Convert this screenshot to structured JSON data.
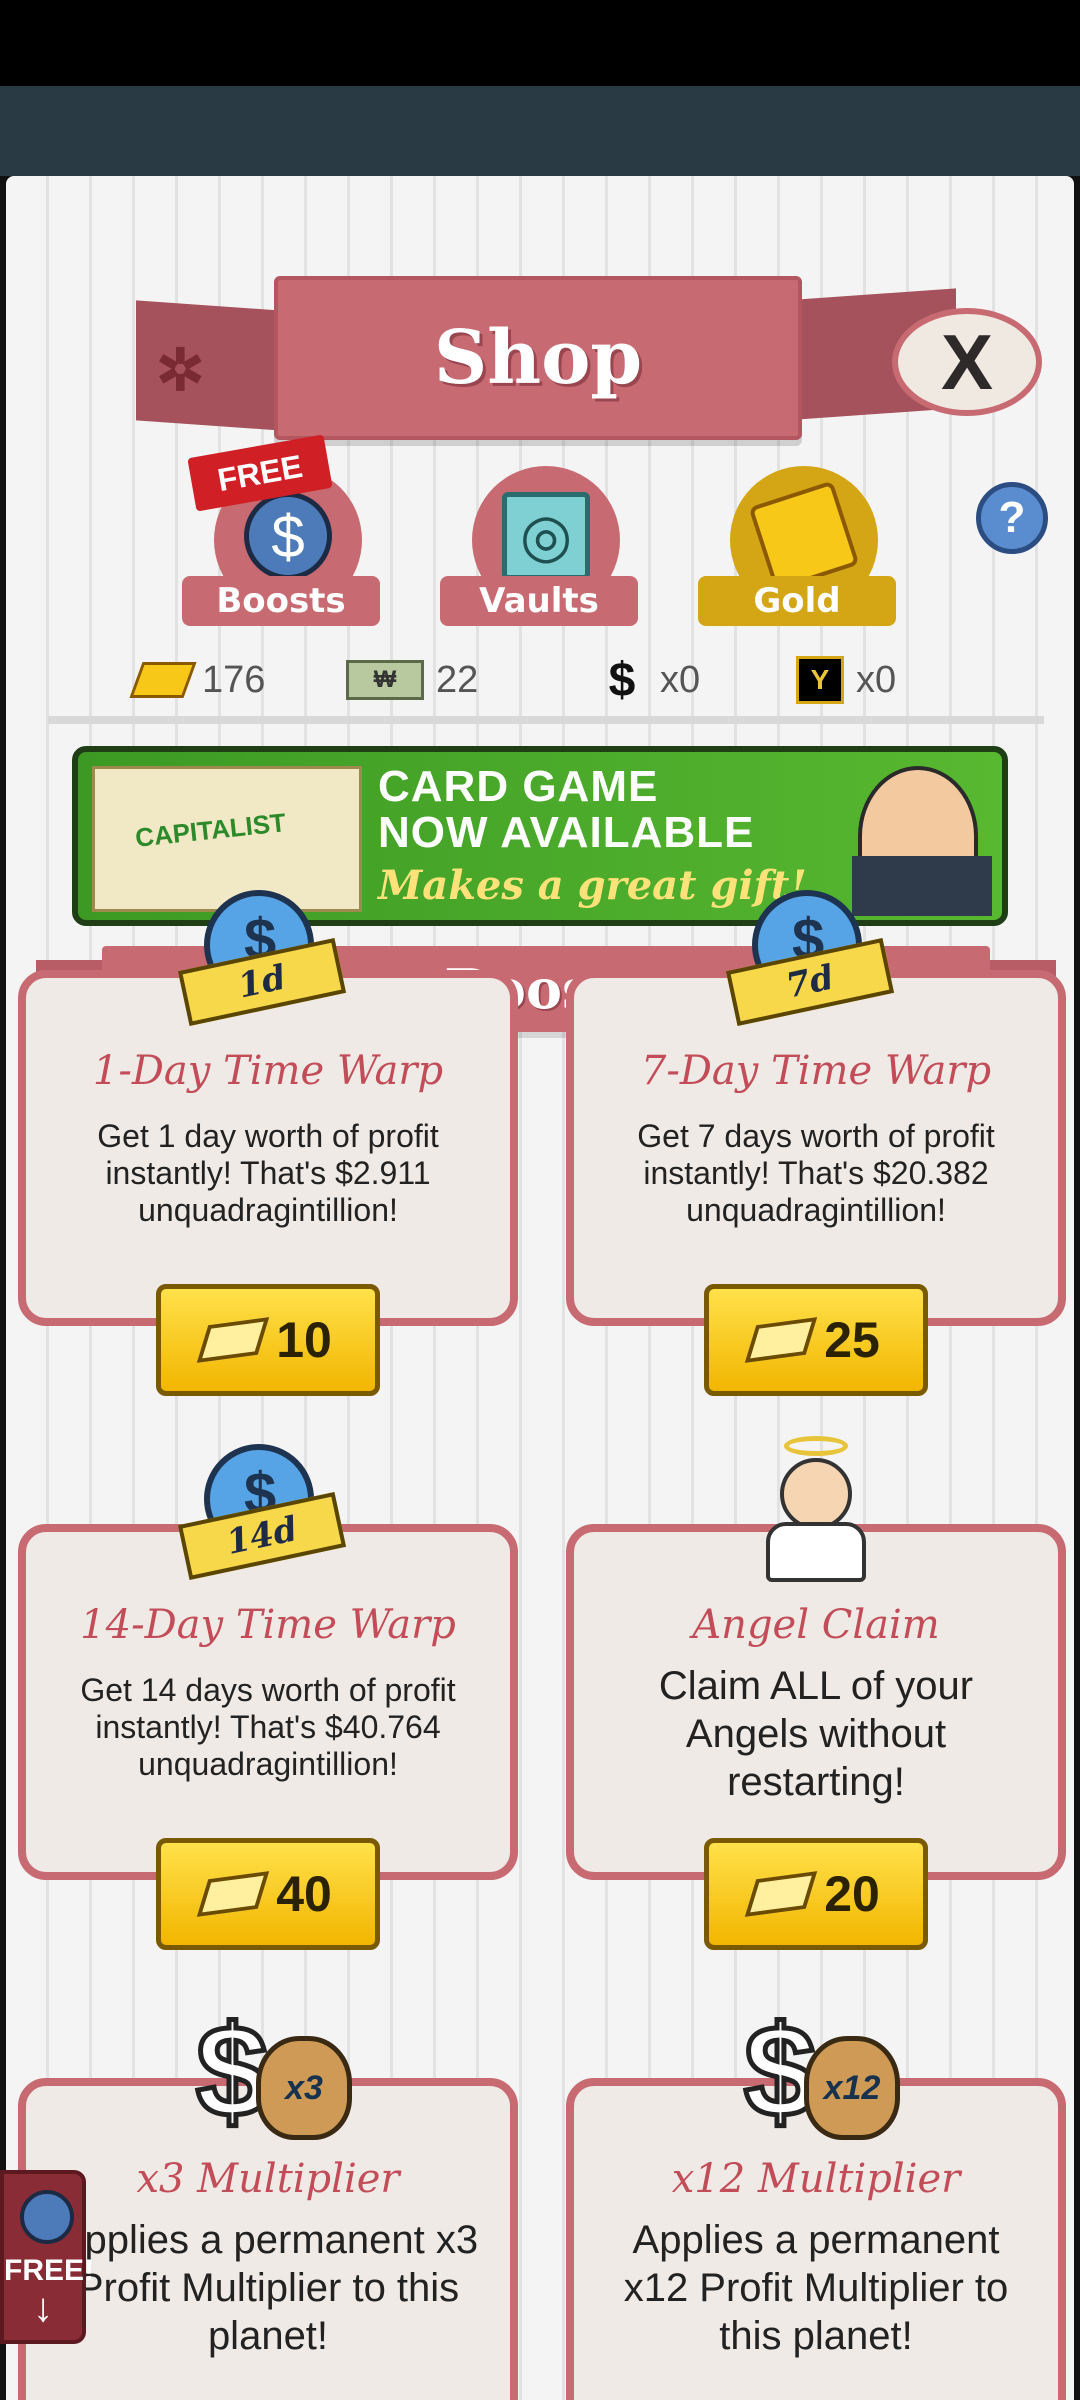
{
  "header": {
    "title": "Shop",
    "close_label": "X"
  },
  "tabs": [
    {
      "label": "Boosts",
      "badge": "FREE"
    },
    {
      "label": "Vaults"
    },
    {
      "label": "Gold",
      "selected": true
    }
  ],
  "help_label": "?",
  "currencies": {
    "gold": "176",
    "megabucks_symbol": "₩",
    "megabucks": "22",
    "multipliers": "x0",
    "microsoft_symbol": "Y",
    "microsoft": "x0"
  },
  "promo": {
    "line1": "CARD GAME",
    "line2": "NOW AVAILABLE",
    "line3": "Makes a great gift!",
    "box_brand": "CAPITALIST"
  },
  "section_title": "Boosts",
  "items": [
    {
      "badge": "1d",
      "name": "1-Day Time Warp",
      "desc": "Get 1 day worth of profit instantly! That's $2.911 unquadragintillion!",
      "price": "10"
    },
    {
      "badge": "7d",
      "name": "7-Day Time Warp",
      "desc": "Get 7 days worth of profit instantly! That's $20.382 unquadragintillion!",
      "price": "25"
    },
    {
      "badge": "14d",
      "name": "14-Day Time Warp",
      "desc": "Get 14 days worth of profit instantly! That's $40.764 unquadragintillion!",
      "price": "40"
    },
    {
      "name": "Angel Claim",
      "desc": "Claim ALL of your Angels without restarting!",
      "price": "20"
    },
    {
      "badge": "x3",
      "name": "x3 Multiplier",
      "desc": "Applies a permanent x3 Profit Multiplier to this planet!"
    },
    {
      "badge": "x12",
      "name": "x12 Multiplier",
      "desc": "Applies a permanent x12 Profit Multiplier to this planet!"
    }
  ],
  "free_button": {
    "label": "FREE!",
    "arrow": "↓"
  },
  "colors": {
    "panel_pink": "#c86a72",
    "gold": "#f2b600",
    "promo_green": "#58b830"
  }
}
